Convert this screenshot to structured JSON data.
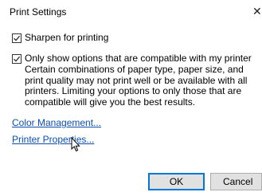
{
  "dialog": {
    "title": "Print Settings",
    "close_glyph": "✕"
  },
  "options": {
    "sharpen": {
      "label": "Sharpen for printing",
      "checked": true
    },
    "compatible": {
      "label": "Only show options that are compatible with my printer",
      "checked": true,
      "description": "Certain combinations of paper type, paper size, and print quality may not print well or be available with all printers. Limiting your options to only those that are compatible will give you the best results."
    }
  },
  "links": {
    "color_management": "Color Management...",
    "printer_properties": "Printer Properties..."
  },
  "buttons": {
    "ok": "OK",
    "cancel": "Cancel"
  },
  "colors": {
    "link": "#0a4fb0",
    "focus_border": "#0078d7",
    "button_face": "#e1e1e1"
  },
  "icons": {
    "close": "close-icon",
    "checkmark": "checkmark-icon",
    "cursor": "mouse-pointer-icon"
  }
}
